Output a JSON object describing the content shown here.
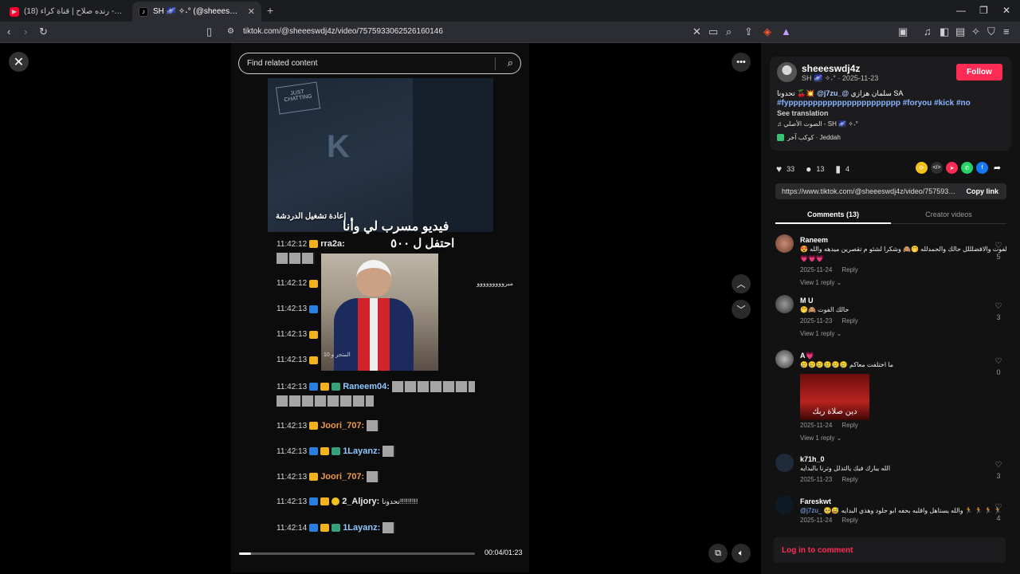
{
  "browser": {
    "tabs": [
      {
        "title": "(18) كويتي كويتي - رنده صلاح | قناة كراء",
        "favicon": "youtube-icon"
      },
      {
        "title": "SH 🌌 ✧˖° (@sheeeswdj4z) | TikTok",
        "favicon": "tiktok-icon"
      }
    ],
    "url": "tiktok.com/@sheeeswdj4z/video/7575933062526160146"
  },
  "video": {
    "search_placeholder": "Find related content",
    "overlay_title": "فيديو مسرب لي وأنا",
    "overlay_subtitle": "احتفل ل ٥٠٠",
    "overlay_replay": "إعادة تشغيل الدردشة",
    "stream_logo": "JUST CHATTING",
    "stream_brand": "K",
    "person_caption": "المتجر و 10",
    "chat": [
      {
        "time": "11:42:12",
        "user": "rra2a:",
        "style": "orange",
        "badges": [
          "crown"
        ]
      },
      {
        "time": "11:42:12",
        "user": "",
        "style": "white",
        "badges": [
          "crown"
        ],
        "text": "مبرووووووووو"
      },
      {
        "time": "11:42:13",
        "user": "",
        "style": "white",
        "badges": [
          "blue",
          "crown"
        ]
      },
      {
        "time": "11:42:13",
        "user": "",
        "style": "white",
        "badges": [
          "crown"
        ]
      },
      {
        "time": "11:42:13",
        "user": "",
        "style": "white",
        "badges": [
          "crown"
        ]
      },
      {
        "time": "11:42:13",
        "user": "Raneem04:",
        "style": "blue",
        "badges": [
          "blue",
          "crown",
          "green"
        ]
      },
      {
        "time": "11:42:13",
        "user": "Joori_707:",
        "style": "orange",
        "badges": [
          "crown"
        ]
      },
      {
        "time": "11:42:13",
        "user": "1Layanz:",
        "style": "blue",
        "badges": [
          "blue",
          "crown",
          "green"
        ]
      },
      {
        "time": "11:42:13",
        "user": "Joori_707:",
        "style": "orange",
        "badges": [
          "crown"
        ]
      },
      {
        "time": "11:42:13",
        "user": "2_Aljory:",
        "style": "white",
        "badges": [
          "blue",
          "crown",
          "coin"
        ],
        "text": "تحدونا!!!!!!!!!"
      },
      {
        "time": "11:42:14",
        "user": "1Layanz:",
        "style": "blue",
        "badges": [
          "blue",
          "crown",
          "green"
        ]
      }
    ],
    "time": "00:04/01:23",
    "progress": 0.05
  },
  "post": {
    "username": "sheeeswdj4z",
    "subline": "SH 🌌 ✧˖° · 2025-11-23",
    "follow_label": "Follow",
    "caption_line1_text": "تحدونا 🍒💥 ",
    "caption_mention": "@j7zu_@",
    "caption_line1_tail": " سلمان هزازي SA",
    "hashtags": "#fyppppppppppppppppppppppp #foryou #kick #no",
    "see_translation": "See translation",
    "music": "♫  الصوت الأصلي - SH 🌌 ✧˖°",
    "location": "كوكب آخر · Jeddah",
    "likes": "33",
    "comments_count": "13",
    "saves": "4",
    "link": "https://www.tiktok.com/@sheeeswdj4z/video/7575933...",
    "copy_link": "Copy link",
    "tab_comments": "Comments (13)",
    "tab_creator": "Creator videos",
    "login_label": "Log in to comment"
  },
  "comments": [
    {
      "name": "Raneem",
      "text": "الفوت والافضلللل حالك والحمدلله 🤭🙈 وشكرا لشئو م تقصرين ميدهه والله 😍",
      "text2": "💗💗💗",
      "date": "2025-11-24",
      "reply": "Reply",
      "view_replies": "View 1 reply",
      "likes": "5"
    },
    {
      "name": "M U",
      "text": "حالك الفوت 🙈🤭",
      "date": "2025-11-23",
      "reply": "Reply",
      "view_replies": "View 1 reply",
      "likes": "3"
    },
    {
      "name": "A💗",
      "text": "ما اختلفت معاكم 🥲🥲🥲🥲🥲🥲",
      "date": "2025-11-24",
      "reply": "Reply",
      "view_replies": "View 1 reply",
      "likes": "0",
      "sticker_text": "دين صلاة ربك"
    },
    {
      "name": "k71h_0",
      "text": "الله يبارك فيك يالتدلل وترنا بالبدايه",
      "date": "2025-11-23",
      "reply": "Reply",
      "likes": "3"
    },
    {
      "name": "Fareskwt",
      "mention": "@j7zu_ 🥺😅",
      "text": "والله يستاهل واقلبه بحفه ابو حلود وهذي البدايه 🏃 🏃 🏃 🏃",
      "date": "2025-11-24",
      "reply": "Reply",
      "likes": "4"
    }
  ],
  "colors": {
    "follow": "#fe2c55",
    "hashtag": "#8ab4ff",
    "chat_orange": "#f19a4a",
    "chat_blue": "#8fc8ff"
  }
}
